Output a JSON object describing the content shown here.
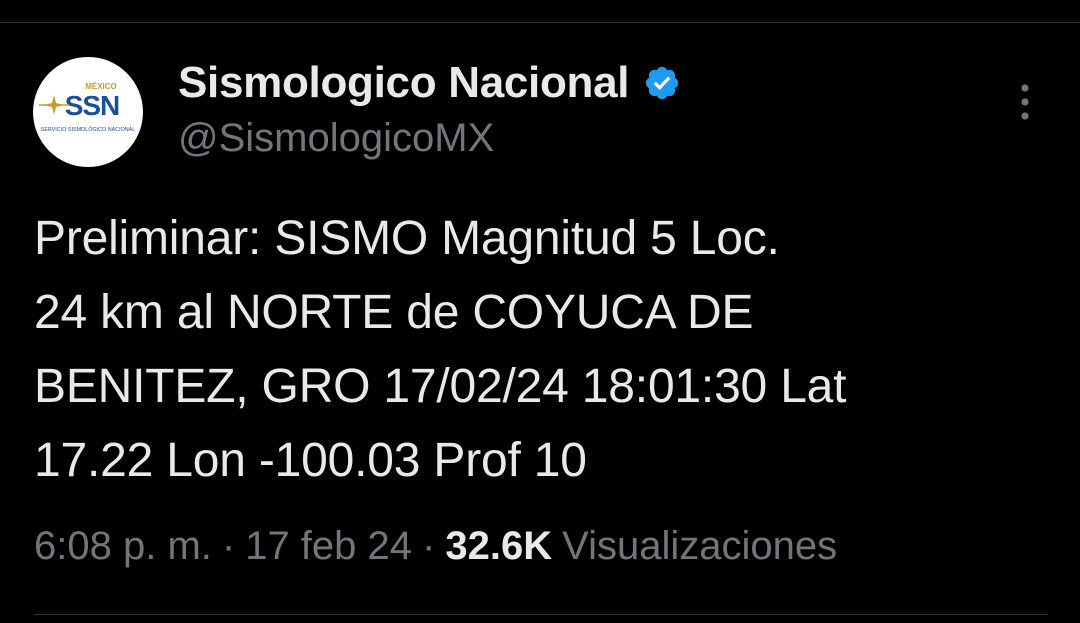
{
  "tweet": {
    "author": {
      "display_name": "Sismologico Nacional",
      "handle": "@SismologicoMX",
      "verified": true,
      "verified_icon": "verified-badge-icon",
      "avatar": {
        "logo_text": "SSN",
        "logo_country": "MÉXICO",
        "logo_subtitle": "SERVICIO SISMOLÓGICO NACIONAL"
      }
    },
    "text": "Preliminar: SISMO Magnitud 5 Loc.\n24 km al NORTE de COYUCA DE\nBENITEZ, GRO 17/02/24 18:01:30 Lat\n17.22 Lon -100.03 Prof 10",
    "time": "6:08 p. m.",
    "date": "17 feb 24",
    "separator": "·",
    "views_count": "32.6K",
    "views_label": "Visualizaciones",
    "more_icon": "more-vertical-icon"
  },
  "colors": {
    "background": "#000000",
    "primary_text": "#e7e9ea",
    "secondary_text": "#71767b",
    "verified_blue": "#1d9bf0",
    "divider": "#2f3336",
    "ssn_blue": "#1b4f9c",
    "ssn_gold": "#c89b2c"
  }
}
